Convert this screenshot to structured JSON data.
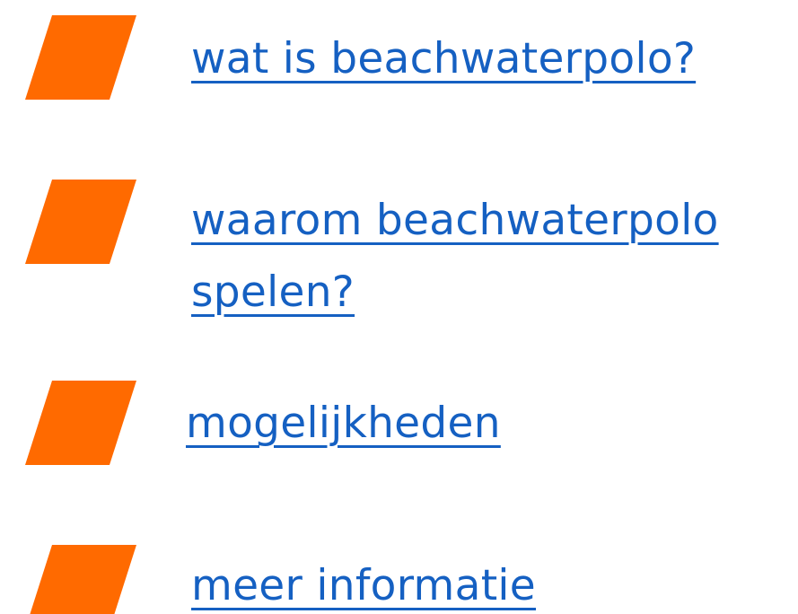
{
  "colors": {
    "marker": "#FF6A00",
    "link": "#1560C2",
    "background": "#FFFFFF"
  },
  "menu": {
    "items": [
      {
        "label": "wat is beachwaterpolo?",
        "icon": "orange-parallelogram-icon"
      },
      {
        "label_line1": "waarom beachwaterpolo",
        "label_line2": "spelen?",
        "icon": "orange-parallelogram-icon"
      },
      {
        "label": "mogelijkheden",
        "icon": "orange-parallelogram-icon"
      },
      {
        "label": "meer informatie",
        "icon": "orange-parallelogram-icon"
      }
    ]
  }
}
